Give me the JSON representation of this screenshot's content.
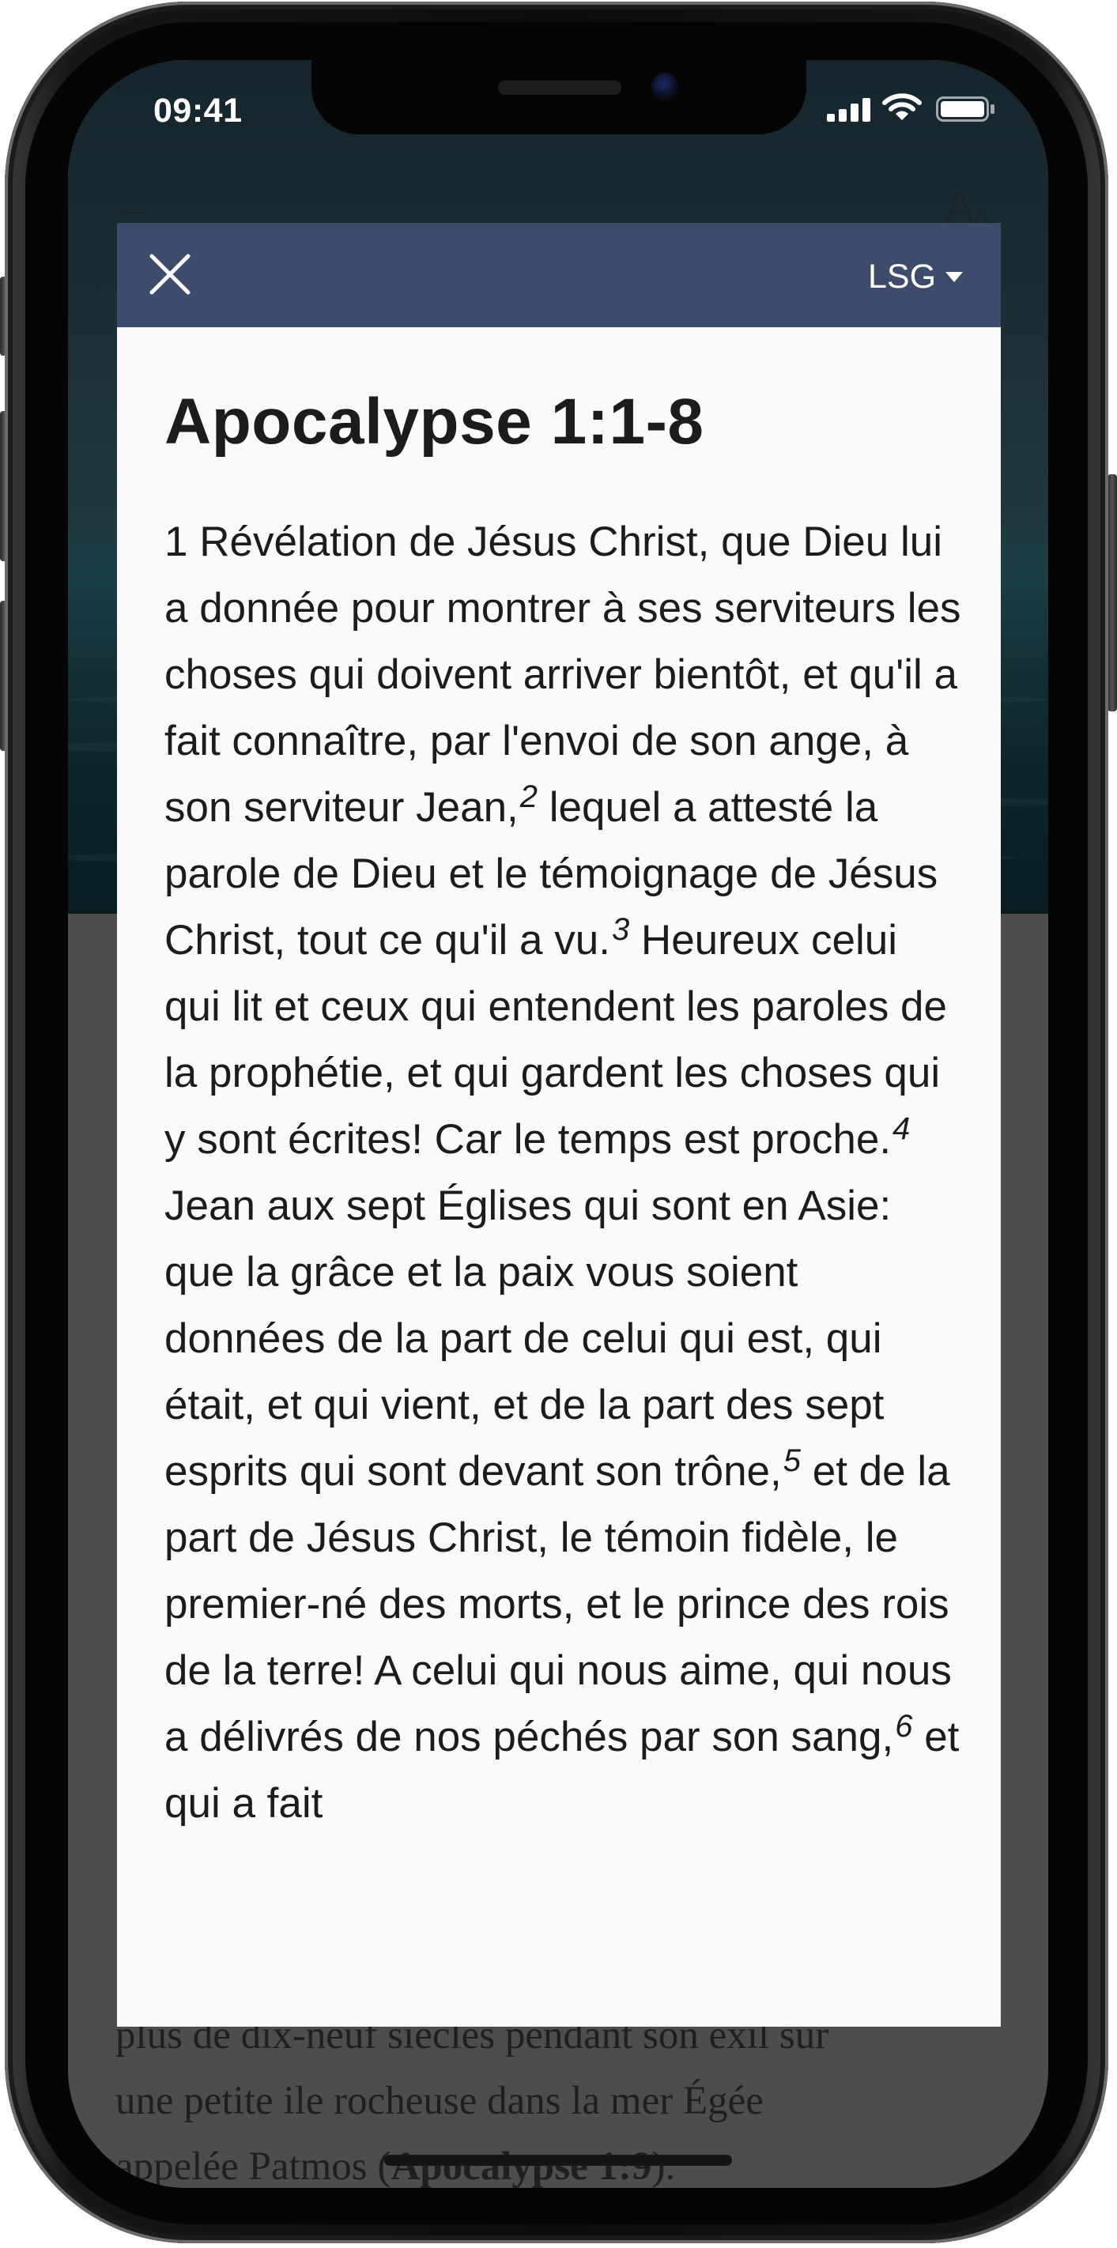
{
  "status_bar": {
    "time": "09:41"
  },
  "background": {
    "underlying_text_lines": [
      "plus de dix-neuf siècles pendant son exil sur",
      "une petite ile rocheuse dans la mer Égée",
      "appelée Patmos ("
    ],
    "underlying_reference": "Apocalypse 1:9",
    "underlying_tail": ")."
  },
  "modal": {
    "version_label": "LSG",
    "title": "Apocalypse 1:1-8",
    "verses": [
      {
        "number": "1",
        "text": "Révélation de Jésus Christ, que Dieu lui a donnée pour montrer à ses serviteurs les choses qui doivent arriver bientôt, et qu'il a fait connaître, par l'envoi de son ange, à son serviteur Jean,"
      },
      {
        "number": "2",
        "text": "lequel a attesté la parole de Dieu et le témoignage de Jésus Christ, tout ce qu'il a vu."
      },
      {
        "number": "3",
        "text": "Heureux celui qui lit et ceux qui entendent les paroles de la prophétie, et qui gardent les choses qui y sont écrites! Car le temps est proche."
      },
      {
        "number": "4",
        "text": "Jean aux sept Églises qui sont en Asie: que la grâce et la paix vous soient données de la part de celui qui est, qui était, et qui vient, et de la part des sept esprits qui sont devant son trône,"
      },
      {
        "number": "5",
        "text": "et de la part de Jésus Christ, le témoin fidèle, le premier-né des morts, et le prince des rois de la terre! A celui qui nous aime, qui nous a délivrés de nos péchés par son sang,"
      },
      {
        "number": "6",
        "text": "et qui a fait"
      }
    ]
  },
  "icons": {
    "close": "close-icon",
    "caret": "caret-down-icon",
    "signal": "cellular-signal-icon",
    "wifi": "wifi-icon",
    "battery": "battery-icon",
    "back": "back-arrow-icon",
    "font_size": "font-size-icon"
  },
  "colors": {
    "modal_header": "#3e4c6b",
    "modal_background": "#fafafa",
    "text": "#1c1c1c"
  }
}
